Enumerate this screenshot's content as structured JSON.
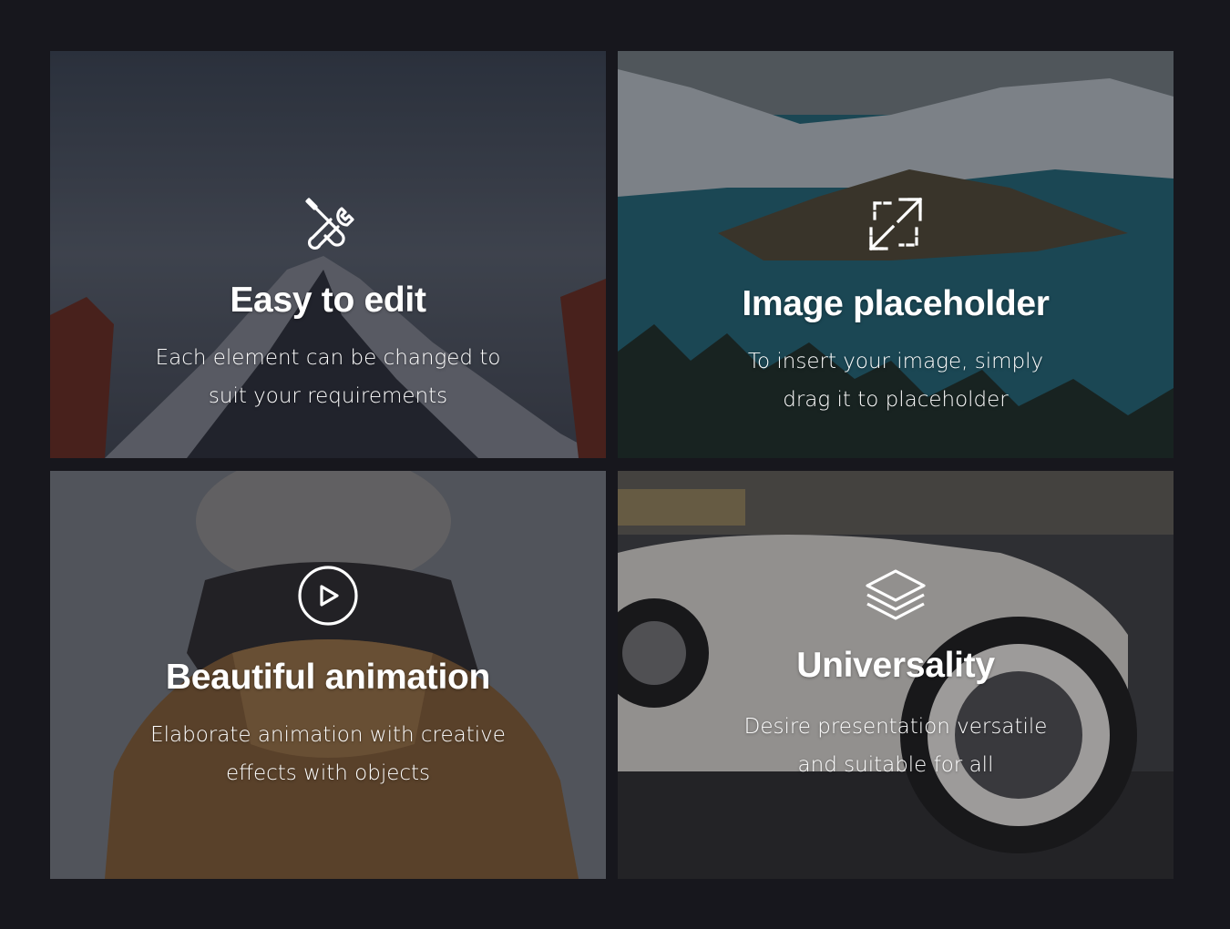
{
  "features": [
    {
      "icon": "tools-icon",
      "title": "Easy to edit",
      "line1": "Each element can be changed to",
      "line2": "suit your requirements"
    },
    {
      "icon": "expand-arrows-icon",
      "title": "Image placeholder",
      "line1": "To insert your image, simply",
      "line2": "drag it to placeholder"
    },
    {
      "icon": "play-circle-icon",
      "title": "Beautiful animation",
      "line1": "Elaborate animation with creative",
      "line2": "effects with objects"
    },
    {
      "icon": "layers-icon",
      "title": "Universality",
      "line1": "Desire presentation versatile",
      "line2": "and suitable for all"
    }
  ],
  "colors": {
    "page_background": "#17171d",
    "text": "#ffffff"
  }
}
